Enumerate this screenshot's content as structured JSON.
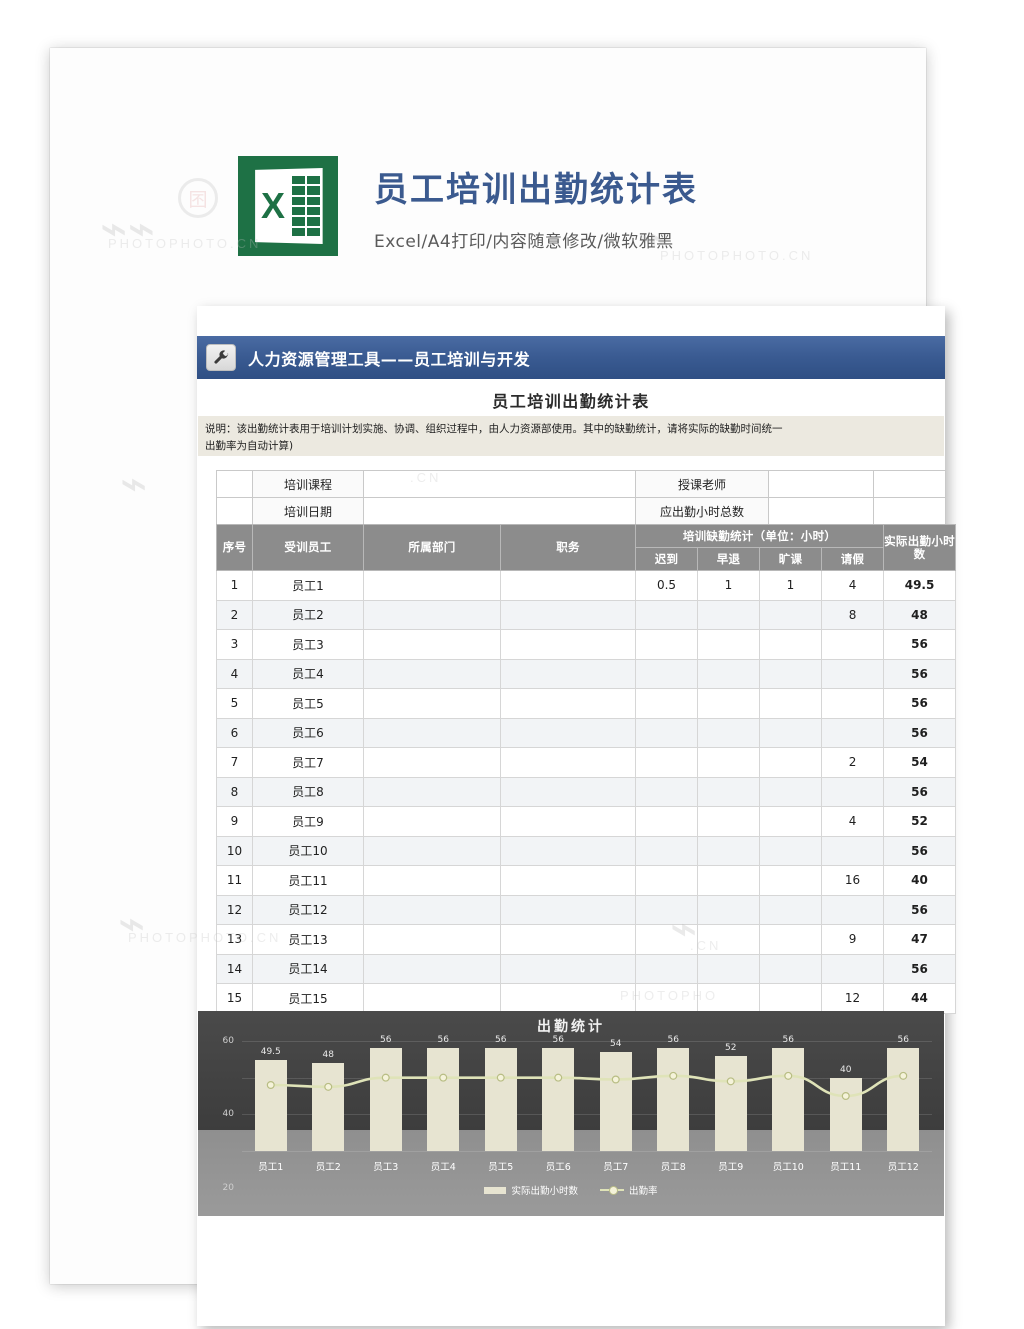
{
  "masthead": {
    "title": "员工培训出勤统计表",
    "subtitle": "Excel/A4打印/内容随意修改/微软雅黑",
    "logo_letter": "X",
    "logo_name": "excel-logo"
  },
  "banner": {
    "icon": "wrench-icon",
    "title": "人力资源管理工具——员工培训与开发",
    "color": "#3a5b92"
  },
  "sheet": {
    "title": "员工培训出勤统计表",
    "note_line1": "说明：该出勤统计表用于培训计划实施、协调、组织过程中，由人力资源部使用。其中的缺勤统计，请将实际的缺勤时间统一",
    "note_line2": "出勤率为自动计算)"
  },
  "info_fields": [
    {
      "label": "培训课程",
      "value": "",
      "label2": "授课老师",
      "value2": ""
    },
    {
      "label": "培训日期",
      "value": "",
      "label2": "应出勤小时总数",
      "value2": ""
    }
  ],
  "table": {
    "headers": {
      "index": "序号",
      "employee": "受训员工",
      "department": "所属部门",
      "position": "职务",
      "absence_group": "培训缺勤统计（单位：小时）",
      "late": "迟到",
      "early_leave": "早退",
      "truancy": "旷课",
      "leave": "请假",
      "actual_hours": "实际出勤小时数"
    },
    "rows": [
      {
        "index": "1",
        "employee": "员工1",
        "department": "",
        "position": "",
        "late": "0.5",
        "early_leave": "1",
        "truancy": "1",
        "leave": "4",
        "actual_hours": "49.5"
      },
      {
        "index": "2",
        "employee": "员工2",
        "department": "",
        "position": "",
        "late": "",
        "early_leave": "",
        "truancy": "",
        "leave": "8",
        "actual_hours": "48"
      },
      {
        "index": "3",
        "employee": "员工3",
        "department": "",
        "position": "",
        "late": "",
        "early_leave": "",
        "truancy": "",
        "leave": "",
        "actual_hours": "56"
      },
      {
        "index": "4",
        "employee": "员工4",
        "department": "",
        "position": "",
        "late": "",
        "early_leave": "",
        "truancy": "",
        "leave": "",
        "actual_hours": "56"
      },
      {
        "index": "5",
        "employee": "员工5",
        "department": "",
        "position": "",
        "late": "",
        "early_leave": "",
        "truancy": "",
        "leave": "",
        "actual_hours": "56"
      },
      {
        "index": "6",
        "employee": "员工6",
        "department": "",
        "position": "",
        "late": "",
        "early_leave": "",
        "truancy": "",
        "leave": "",
        "actual_hours": "56"
      },
      {
        "index": "7",
        "employee": "员工7",
        "department": "",
        "position": "",
        "late": "",
        "early_leave": "",
        "truancy": "",
        "leave": "2",
        "actual_hours": "54"
      },
      {
        "index": "8",
        "employee": "员工8",
        "department": "",
        "position": "",
        "late": "",
        "early_leave": "",
        "truancy": "",
        "leave": "",
        "actual_hours": "56"
      },
      {
        "index": "9",
        "employee": "员工9",
        "department": "",
        "position": "",
        "late": "",
        "early_leave": "",
        "truancy": "",
        "leave": "4",
        "actual_hours": "52"
      },
      {
        "index": "10",
        "employee": "员工10",
        "department": "",
        "position": "",
        "late": "",
        "early_leave": "",
        "truancy": "",
        "leave": "",
        "actual_hours": "56"
      },
      {
        "index": "11",
        "employee": "员工11",
        "department": "",
        "position": "",
        "late": "",
        "early_leave": "",
        "truancy": "",
        "leave": "16",
        "actual_hours": "40"
      },
      {
        "index": "12",
        "employee": "员工12",
        "department": "",
        "position": "",
        "late": "",
        "early_leave": "",
        "truancy": "",
        "leave": "",
        "actual_hours": "56"
      },
      {
        "index": "13",
        "employee": "员工13",
        "department": "",
        "position": "",
        "late": "",
        "early_leave": "",
        "truancy": "",
        "leave": "9",
        "actual_hours": "47"
      },
      {
        "index": "14",
        "employee": "员工14",
        "department": "",
        "position": "",
        "late": "",
        "early_leave": "",
        "truancy": "",
        "leave": "",
        "actual_hours": "56"
      },
      {
        "index": "15",
        "employee": "员工15",
        "department": "",
        "position": "",
        "late": "",
        "early_leave": "",
        "truancy": "",
        "leave": "12",
        "actual_hours": "44"
      }
    ]
  },
  "chart_data": {
    "type": "bar",
    "title": "出勤统计",
    "xlabel": "",
    "ylabel": "",
    "ylim": [
      0,
      60
    ],
    "yticks": [
      0,
      20,
      40,
      60
    ],
    "grid": true,
    "legend_position": "bottom",
    "categories": [
      "员工1",
      "员工2",
      "员工3",
      "员工4",
      "员工5",
      "员工6",
      "员工7",
      "员工8",
      "员工9",
      "员工10",
      "员工11",
      "员工12"
    ],
    "series": [
      {
        "name": "实际出勤小时数",
        "type": "bar",
        "color": "#e7e4d1",
        "values": [
          49.5,
          48,
          56,
          56,
          56,
          56,
          54,
          56,
          52,
          56,
          40,
          56
        ],
        "data_labels": [
          "49.5",
          "48",
          "56",
          "56",
          "56",
          "56",
          "54",
          "56",
          "52",
          "56",
          "40",
          "56"
        ]
      },
      {
        "name": "出勤率",
        "type": "line",
        "color": "#dfe3b8",
        "values": [
          36,
          35,
          40,
          40,
          40,
          40,
          39,
          41,
          38,
          41,
          30,
          41
        ]
      }
    ]
  },
  "watermark": {
    "brand": "PHOTOPHOTO.CN",
    "mark": "图行天下"
  }
}
